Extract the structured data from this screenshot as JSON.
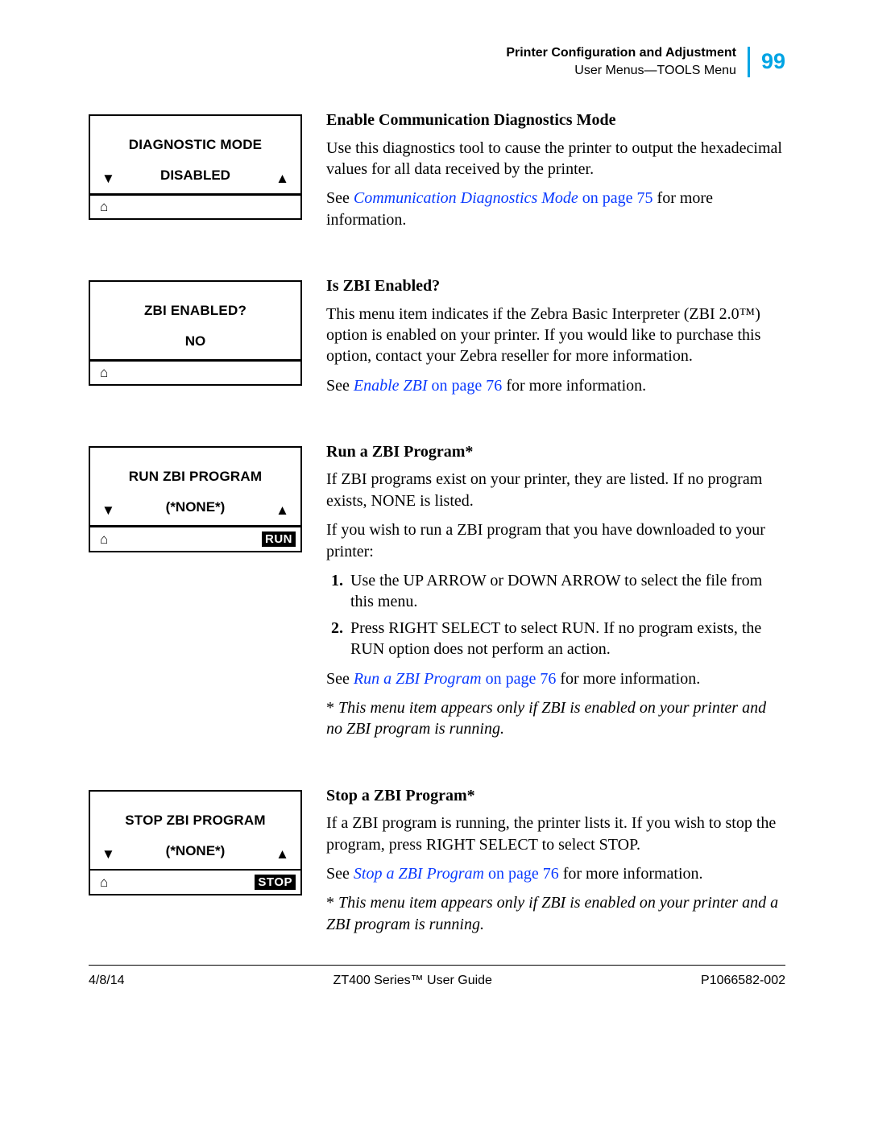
{
  "header": {
    "chapter": "Printer Configuration and Adjustment",
    "section": "User Menus—TOOLS Menu",
    "page_number": "99"
  },
  "sections": {
    "diag": {
      "lcd": {
        "title": "DIAGNOSTIC MODE",
        "value": "DISABLED",
        "left_arrow": "▼",
        "right_arrow": "▲",
        "home": "⌂",
        "badge": ""
      },
      "heading": "Enable Communication Diagnostics Mode",
      "p1": "Use this diagnostics tool to cause the printer to output the hexadecimal values for all data received by the printer.",
      "see_pre": "See ",
      "see_xref": "Communication Diagnostics Mode",
      "see_on": " on page 75",
      "see_post": " for more information."
    },
    "zbi": {
      "lcd": {
        "title": "ZBI ENABLED?",
        "value": "NO",
        "home": "⌂",
        "badge": ""
      },
      "heading": "Is ZBI Enabled?",
      "p1": "This menu item indicates if the Zebra Basic Interpreter (ZBI 2.0™) option is enabled on your printer. If you would like to purchase this option, contact your Zebra reseller for more information.",
      "see_pre": "See ",
      "see_xref": "Enable ZBI",
      "see_on": " on page 76",
      "see_post": " for more information."
    },
    "run": {
      "lcd": {
        "title": "RUN ZBI PROGRAM",
        "value": "(*NONE*)",
        "left_arrow": "▼",
        "right_arrow": "▲",
        "home": "⌂",
        "badge": "RUN"
      },
      "heading": "Run a ZBI Program*",
      "p1": "If ZBI programs exist on your printer, they are listed. If no program exists, NONE is listed.",
      "p2": "If you wish to run a ZBI program that you have downloaded to your printer:",
      "li1": "Use the UP ARROW or DOWN ARROW to select the file from this menu.",
      "li2": "Press RIGHT SELECT to select RUN. If no program exists, the RUN option does not perform an action.",
      "see_pre": "See ",
      "see_xref": "Run a ZBI Program",
      "see_on": " on page 76",
      "see_post": " for more information.",
      "note_ast": "* ",
      "note": "This menu item appears only if ZBI is enabled on your printer and no ZBI program is running."
    },
    "stop": {
      "lcd": {
        "title": "STOP ZBI PROGRAM",
        "value": "(*NONE*)",
        "left_arrow": "▼",
        "right_arrow": "▲",
        "home": "⌂",
        "badge": "STOP"
      },
      "heading": "Stop a ZBI Program*",
      "p1": "If a ZBI program is running, the printer lists it. If you wish to stop the program, press RIGHT SELECT to select STOP.",
      "see_pre": "See ",
      "see_xref": "Stop a ZBI Program",
      "see_on": " on page 76",
      "see_post": " for more information.",
      "note_ast": "* ",
      "note": "This menu item appears only if ZBI is enabled on your printer and a ZBI program is running."
    }
  },
  "footer": {
    "date": "4/8/14",
    "title": "ZT400 Series™ User Guide",
    "docnum": "P1066582-002"
  }
}
